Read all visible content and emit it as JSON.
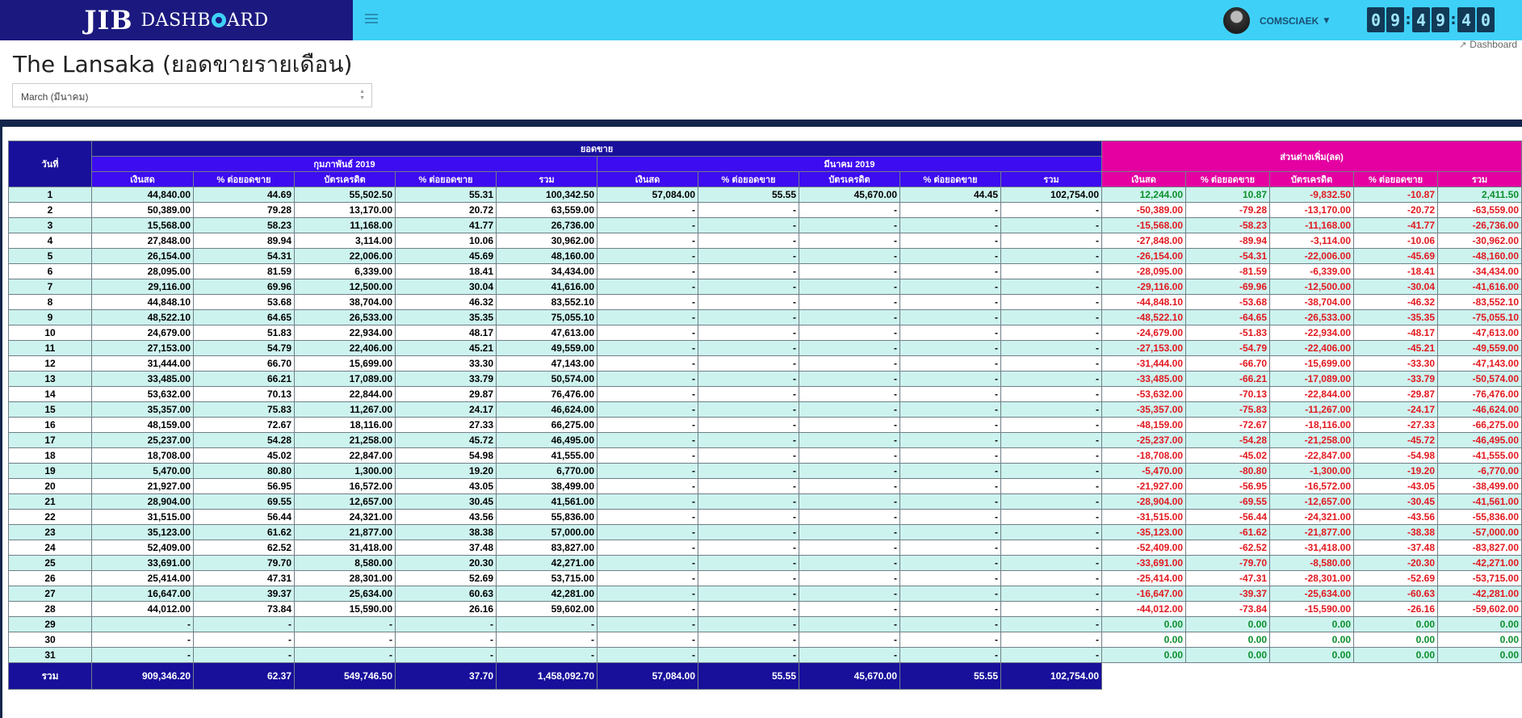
{
  "app": {
    "logo": "JIB",
    "name_pre": "DASHB",
    "name_post": "ARD"
  },
  "header": {
    "username": "COMSCIAEK",
    "clock": [
      "0",
      "9",
      "4",
      "9",
      "4",
      "0"
    ],
    "breadcrumb": "Dashboard",
    "breadcrumb_icon": "line-chart-icon"
  },
  "page": {
    "title": "The Lansaka (ยอดขายรายเดือน)",
    "month_select": "March (มีนาคม)"
  },
  "colors": {
    "brand_bg": "#1b197f",
    "topbar": "#3fd0f7",
    "header_main": "#180f9b",
    "header_sub": "#3d0cf0",
    "header_diff": "#e400a1",
    "row_alt": "#cdf3ef",
    "positive": "#0a8f2a",
    "negative": "#e2191f"
  },
  "table": {
    "day_header": "วันที่",
    "sales_header": "ยอดขาย",
    "diff_header": "ส่วนต่างเพิ่ม(ลด)",
    "prev_month": "กุมภาพันธ์   2019",
    "curr_month": "มีนาคม   2019",
    "columns": [
      "เงินสด",
      "% ต่อยอดขาย",
      "บัตรเครดิต",
      "% ต่อยอดขาย",
      "รวม"
    ],
    "rows": [
      {
        "day": "1",
        "prev": [
          "44,840.00",
          "44.69",
          "55,502.50",
          "55.31",
          "100,342.50"
        ],
        "curr": [
          "57,084.00",
          "55.55",
          "45,670.00",
          "44.45",
          "102,754.00"
        ],
        "diff": [
          "12,244.00",
          "10.87",
          "-9,832.50",
          "-10.87",
          "2,411.50"
        ]
      },
      {
        "day": "2",
        "prev": [
          "50,389.00",
          "79.28",
          "13,170.00",
          "20.72",
          "63,559.00"
        ],
        "curr": [
          "-",
          "-",
          "-",
          "-",
          "-"
        ],
        "diff": [
          "-50,389.00",
          "-79.28",
          "-13,170.00",
          "-20.72",
          "-63,559.00"
        ]
      },
      {
        "day": "3",
        "prev": [
          "15,568.00",
          "58.23",
          "11,168.00",
          "41.77",
          "26,736.00"
        ],
        "curr": [
          "-",
          "-",
          "-",
          "-",
          "-"
        ],
        "diff": [
          "-15,568.00",
          "-58.23",
          "-11,168.00",
          "-41.77",
          "-26,736.00"
        ]
      },
      {
        "day": "4",
        "prev": [
          "27,848.00",
          "89.94",
          "3,114.00",
          "10.06",
          "30,962.00"
        ],
        "curr": [
          "-",
          "-",
          "-",
          "-",
          "-"
        ],
        "diff": [
          "-27,848.00",
          "-89.94",
          "-3,114.00",
          "-10.06",
          "-30,962.00"
        ]
      },
      {
        "day": "5",
        "prev": [
          "26,154.00",
          "54.31",
          "22,006.00",
          "45.69",
          "48,160.00"
        ],
        "curr": [
          "-",
          "-",
          "-",
          "-",
          "-"
        ],
        "diff": [
          "-26,154.00",
          "-54.31",
          "-22,006.00",
          "-45.69",
          "-48,160.00"
        ]
      },
      {
        "day": "6",
        "prev": [
          "28,095.00",
          "81.59",
          "6,339.00",
          "18.41",
          "34,434.00"
        ],
        "curr": [
          "-",
          "-",
          "-",
          "-",
          "-"
        ],
        "diff": [
          "-28,095.00",
          "-81.59",
          "-6,339.00",
          "-18.41",
          "-34,434.00"
        ]
      },
      {
        "day": "7",
        "prev": [
          "29,116.00",
          "69.96",
          "12,500.00",
          "30.04",
          "41,616.00"
        ],
        "curr": [
          "-",
          "-",
          "-",
          "-",
          "-"
        ],
        "diff": [
          "-29,116.00",
          "-69.96",
          "-12,500.00",
          "-30.04",
          "-41,616.00"
        ]
      },
      {
        "day": "8",
        "prev": [
          "44,848.10",
          "53.68",
          "38,704.00",
          "46.32",
          "83,552.10"
        ],
        "curr": [
          "-",
          "-",
          "-",
          "-",
          "-"
        ],
        "diff": [
          "-44,848.10",
          "-53.68",
          "-38,704.00",
          "-46.32",
          "-83,552.10"
        ]
      },
      {
        "day": "9",
        "prev": [
          "48,522.10",
          "64.65",
          "26,533.00",
          "35.35",
          "75,055.10"
        ],
        "curr": [
          "-",
          "-",
          "-",
          "-",
          "-"
        ],
        "diff": [
          "-48,522.10",
          "-64.65",
          "-26,533.00",
          "-35.35",
          "-75,055.10"
        ]
      },
      {
        "day": "10",
        "prev": [
          "24,679.00",
          "51.83",
          "22,934.00",
          "48.17",
          "47,613.00"
        ],
        "curr": [
          "-",
          "-",
          "-",
          "-",
          "-"
        ],
        "diff": [
          "-24,679.00",
          "-51.83",
          "-22,934.00",
          "-48.17",
          "-47,613.00"
        ]
      },
      {
        "day": "11",
        "prev": [
          "27,153.00",
          "54.79",
          "22,406.00",
          "45.21",
          "49,559.00"
        ],
        "curr": [
          "-",
          "-",
          "-",
          "-",
          "-"
        ],
        "diff": [
          "-27,153.00",
          "-54.79",
          "-22,406.00",
          "-45.21",
          "-49,559.00"
        ]
      },
      {
        "day": "12",
        "prev": [
          "31,444.00",
          "66.70",
          "15,699.00",
          "33.30",
          "47,143.00"
        ],
        "curr": [
          "-",
          "-",
          "-",
          "-",
          "-"
        ],
        "diff": [
          "-31,444.00",
          "-66.70",
          "-15,699.00",
          "-33.30",
          "-47,143.00"
        ]
      },
      {
        "day": "13",
        "prev": [
          "33,485.00",
          "66.21",
          "17,089.00",
          "33.79",
          "50,574.00"
        ],
        "curr": [
          "-",
          "-",
          "-",
          "-",
          "-"
        ],
        "diff": [
          "-33,485.00",
          "-66.21",
          "-17,089.00",
          "-33.79",
          "-50,574.00"
        ]
      },
      {
        "day": "14",
        "prev": [
          "53,632.00",
          "70.13",
          "22,844.00",
          "29.87",
          "76,476.00"
        ],
        "curr": [
          "-",
          "-",
          "-",
          "-",
          "-"
        ],
        "diff": [
          "-53,632.00",
          "-70.13",
          "-22,844.00",
          "-29.87",
          "-76,476.00"
        ]
      },
      {
        "day": "15",
        "prev": [
          "35,357.00",
          "75.83",
          "11,267.00",
          "24.17",
          "46,624.00"
        ],
        "curr": [
          "-",
          "-",
          "-",
          "-",
          "-"
        ],
        "diff": [
          "-35,357.00",
          "-75.83",
          "-11,267.00",
          "-24.17",
          "-46,624.00"
        ]
      },
      {
        "day": "16",
        "prev": [
          "48,159.00",
          "72.67",
          "18,116.00",
          "27.33",
          "66,275.00"
        ],
        "curr": [
          "-",
          "-",
          "-",
          "-",
          "-"
        ],
        "diff": [
          "-48,159.00",
          "-72.67",
          "-18,116.00",
          "-27.33",
          "-66,275.00"
        ]
      },
      {
        "day": "17",
        "prev": [
          "25,237.00",
          "54.28",
          "21,258.00",
          "45.72",
          "46,495.00"
        ],
        "curr": [
          "-",
          "-",
          "-",
          "-",
          "-"
        ],
        "diff": [
          "-25,237.00",
          "-54.28",
          "-21,258.00",
          "-45.72",
          "-46,495.00"
        ]
      },
      {
        "day": "18",
        "prev": [
          "18,708.00",
          "45.02",
          "22,847.00",
          "54.98",
          "41,555.00"
        ],
        "curr": [
          "-",
          "-",
          "-",
          "-",
          "-"
        ],
        "diff": [
          "-18,708.00",
          "-45.02",
          "-22,847.00",
          "-54.98",
          "-41,555.00"
        ]
      },
      {
        "day": "19",
        "prev": [
          "5,470.00",
          "80.80",
          "1,300.00",
          "19.20",
          "6,770.00"
        ],
        "curr": [
          "-",
          "-",
          "-",
          "-",
          "-"
        ],
        "diff": [
          "-5,470.00",
          "-80.80",
          "-1,300.00",
          "-19.20",
          "-6,770.00"
        ]
      },
      {
        "day": "20",
        "prev": [
          "21,927.00",
          "56.95",
          "16,572.00",
          "43.05",
          "38,499.00"
        ],
        "curr": [
          "-",
          "-",
          "-",
          "-",
          "-"
        ],
        "diff": [
          "-21,927.00",
          "-56.95",
          "-16,572.00",
          "-43.05",
          "-38,499.00"
        ]
      },
      {
        "day": "21",
        "prev": [
          "28,904.00",
          "69.55",
          "12,657.00",
          "30.45",
          "41,561.00"
        ],
        "curr": [
          "-",
          "-",
          "-",
          "-",
          "-"
        ],
        "diff": [
          "-28,904.00",
          "-69.55",
          "-12,657.00",
          "-30.45",
          "-41,561.00"
        ]
      },
      {
        "day": "22",
        "prev": [
          "31,515.00",
          "56.44",
          "24,321.00",
          "43.56",
          "55,836.00"
        ],
        "curr": [
          "-",
          "-",
          "-",
          "-",
          "-"
        ],
        "diff": [
          "-31,515.00",
          "-56.44",
          "-24,321.00",
          "-43.56",
          "-55,836.00"
        ]
      },
      {
        "day": "23",
        "prev": [
          "35,123.00",
          "61.62",
          "21,877.00",
          "38.38",
          "57,000.00"
        ],
        "curr": [
          "-",
          "-",
          "-",
          "-",
          "-"
        ],
        "diff": [
          "-35,123.00",
          "-61.62",
          "-21,877.00",
          "-38.38",
          "-57,000.00"
        ]
      },
      {
        "day": "24",
        "prev": [
          "52,409.00",
          "62.52",
          "31,418.00",
          "37.48",
          "83,827.00"
        ],
        "curr": [
          "-",
          "-",
          "-",
          "-",
          "-"
        ],
        "diff": [
          "-52,409.00",
          "-62.52",
          "-31,418.00",
          "-37.48",
          "-83,827.00"
        ]
      },
      {
        "day": "25",
        "prev": [
          "33,691.00",
          "79.70",
          "8,580.00",
          "20.30",
          "42,271.00"
        ],
        "curr": [
          "-",
          "-",
          "-",
          "-",
          "-"
        ],
        "diff": [
          "-33,691.00",
          "-79.70",
          "-8,580.00",
          "-20.30",
          "-42,271.00"
        ]
      },
      {
        "day": "26",
        "prev": [
          "25,414.00",
          "47.31",
          "28,301.00",
          "52.69",
          "53,715.00"
        ],
        "curr": [
          "-",
          "-",
          "-",
          "-",
          "-"
        ],
        "diff": [
          "-25,414.00",
          "-47.31",
          "-28,301.00",
          "-52.69",
          "-53,715.00"
        ]
      },
      {
        "day": "27",
        "prev": [
          "16,647.00",
          "39.37",
          "25,634.00",
          "60.63",
          "42,281.00"
        ],
        "curr": [
          "-",
          "-",
          "-",
          "-",
          "-"
        ],
        "diff": [
          "-16,647.00",
          "-39.37",
          "-25,634.00",
          "-60.63",
          "-42,281.00"
        ]
      },
      {
        "day": "28",
        "prev": [
          "44,012.00",
          "73.84",
          "15,590.00",
          "26.16",
          "59,602.00"
        ],
        "curr": [
          "-",
          "-",
          "-",
          "-",
          "-"
        ],
        "diff": [
          "-44,012.00",
          "-73.84",
          "-15,590.00",
          "-26.16",
          "-59,602.00"
        ]
      },
      {
        "day": "29",
        "prev": [
          "-",
          "-",
          "-",
          "-",
          "-"
        ],
        "curr": [
          "-",
          "-",
          "-",
          "-",
          "-"
        ],
        "diff": [
          "0.00",
          "0.00",
          "0.00",
          "0.00",
          "0.00"
        ]
      },
      {
        "day": "30",
        "prev": [
          "-",
          "-",
          "-",
          "-",
          "-"
        ],
        "curr": [
          "-",
          "-",
          "-",
          "-",
          "-"
        ],
        "diff": [
          "0.00",
          "0.00",
          "0.00",
          "0.00",
          "0.00"
        ]
      },
      {
        "day": "31",
        "prev": [
          "-",
          "-",
          "-",
          "-",
          "-"
        ],
        "curr": [
          "-",
          "-",
          "-",
          "-",
          "-"
        ],
        "diff": [
          "0.00",
          "0.00",
          "0.00",
          "0.00",
          "0.00"
        ]
      }
    ],
    "total": {
      "label": "รวม",
      "prev": [
        "909,346.20",
        "62.37",
        "549,746.50",
        "37.70",
        "1,458,092.70"
      ],
      "curr": [
        "57,084.00",
        "55.55",
        "45,670.00",
        "55.55",
        "102,754.00"
      ]
    }
  }
}
